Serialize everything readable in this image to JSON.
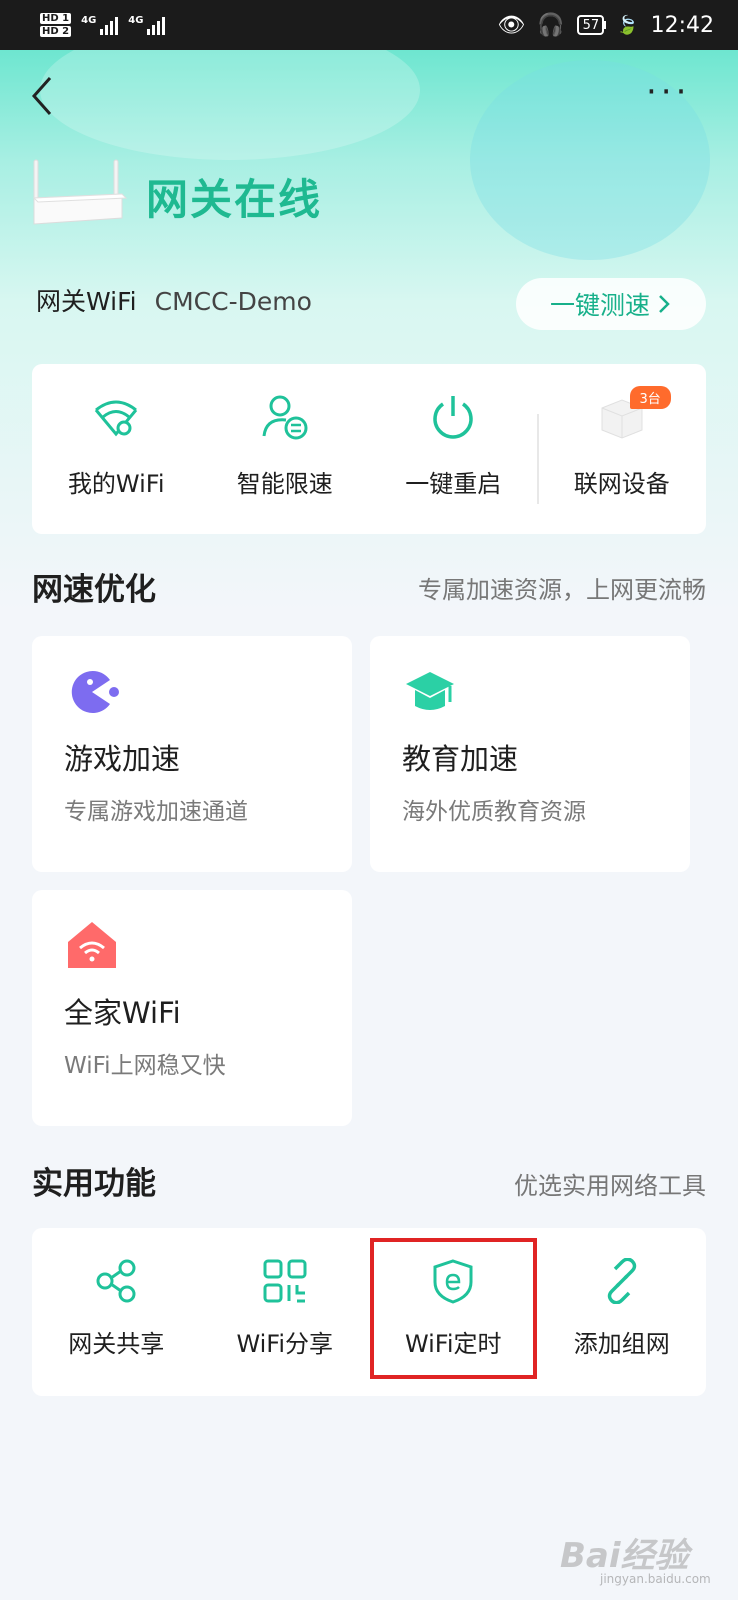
{
  "status_bar": {
    "hd1": "HD 1",
    "hd2": "HD 2",
    "net1": "4G",
    "net2": "4G",
    "battery": "57",
    "time": "12:42"
  },
  "header": {
    "gateway_status": "网关在线",
    "wifi_label": "网关WiFi",
    "wifi_name": "CMCC-Demo",
    "speed_test": "一键测速"
  },
  "quick_actions": [
    {
      "label": "我的WiFi",
      "icon": "wifi-settings-icon"
    },
    {
      "label": "智能限速",
      "icon": "user-speed-icon"
    },
    {
      "label": "一键重启",
      "icon": "power-icon"
    },
    {
      "label": "联网设备",
      "icon": "device-box-icon",
      "badge": "3台"
    }
  ],
  "speed_section": {
    "title": "网速优化",
    "subtitle": "专属加速资源，上网更流畅",
    "cards": [
      {
        "title": "游戏加速",
        "subtitle": "专属游戏加速通道",
        "icon": "pacman-icon"
      },
      {
        "title": "教育加速",
        "subtitle": "海外优质教育资源",
        "icon": "graduation-cap-icon"
      },
      {
        "title": "全家WiFi",
        "subtitle": "WiFi上网稳又快",
        "icon": "home-wifi-icon"
      }
    ]
  },
  "tools_section": {
    "title": "实用功能",
    "subtitle": "优选实用网络工具",
    "items": [
      {
        "label": "网关共享",
        "icon": "share-icon"
      },
      {
        "label": "WiFi分享",
        "icon": "qr-code-icon"
      },
      {
        "label": "WiFi定时",
        "icon": "shield-timer-icon"
      },
      {
        "label": "添加组网",
        "icon": "link-icon"
      }
    ]
  },
  "colors": {
    "accent": "#1fb991",
    "badge": "#ff6b2c",
    "highlight": "#e02424"
  },
  "watermark": {
    "main": "Bai经验",
    "sub": "jingyan.baidu.com"
  }
}
